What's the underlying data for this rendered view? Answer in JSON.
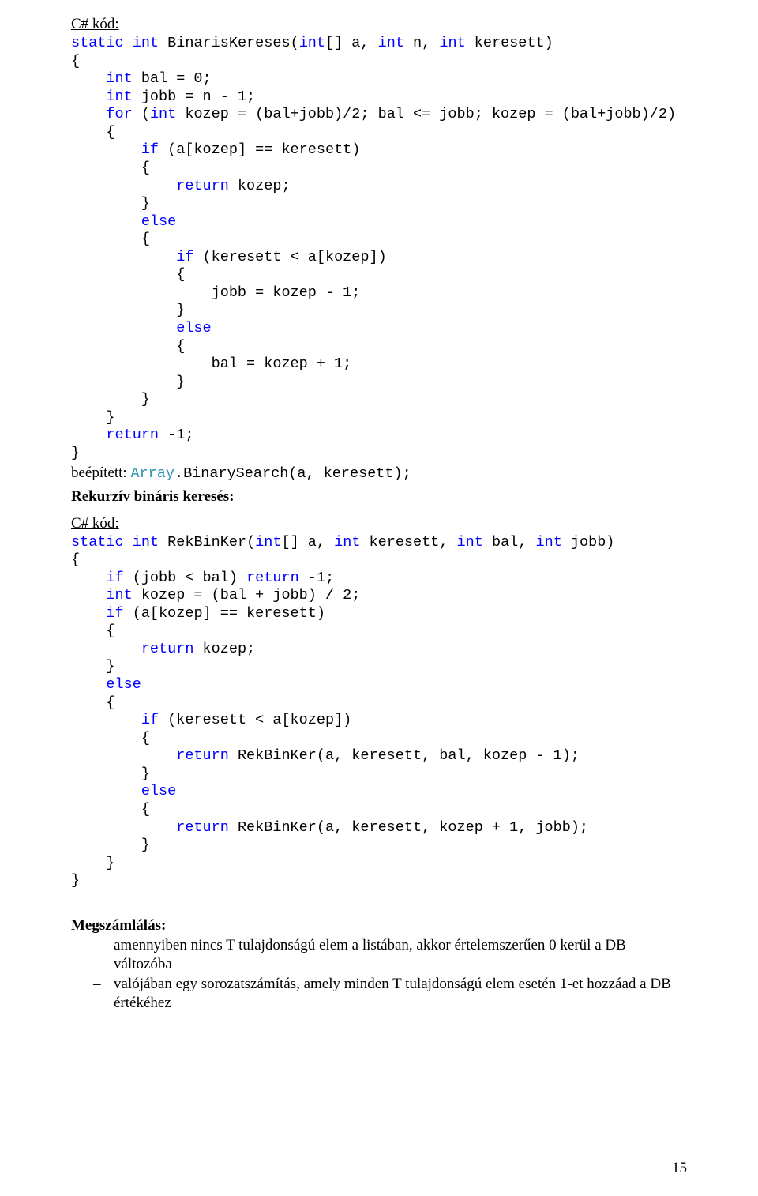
{
  "heading_code1": "C# kód:",
  "code1": {
    "l1a": "static",
    "l1b": " int",
    "l1c": " BinarisKereses(",
    "l1d": "int",
    "l1e": "[] a, ",
    "l1f": "int",
    "l1g": " n, ",
    "l1h": "int",
    "l1i": " keresett)",
    "l2": "{",
    "l3a": "    int",
    "l3b": " bal = 0;",
    "l4a": "    int",
    "l4b": " jobb = n - 1;",
    "l5a": "    for",
    "l5b": " (",
    "l5c": "int",
    "l5d": " kozep = (bal+jobb)/2; bal <= jobb; kozep = (bal+jobb)/2)",
    "l6": "    {",
    "l7a": "        if",
    "l7b": " (a[kozep] == keresett)",
    "l8": "        {",
    "l9a": "            return",
    "l9b": " kozep;",
    "l10": "        }",
    "l11a": "        else",
    "l12": "        {",
    "l13a": "            if",
    "l13b": " (keresett < a[kozep])",
    "l14": "            {",
    "l15": "                jobb = kozep - 1;",
    "l16": "            }",
    "l17a": "            else",
    "l18": "            {",
    "l19": "                bal = kozep + 1;",
    "l20": "            }",
    "l21": "        }",
    "l22": "    }",
    "l23a": "    return",
    "l23b": " -1;",
    "l24": "}"
  },
  "built_label": "beépített: ",
  "built_code_a": "Array",
  "built_code_b": ".BinarySearch(a, keresett);",
  "section_title": "Rekurzív bináris keresés:",
  "heading_code2": "C# kód:",
  "code2": {
    "l1a": "static",
    "l1b": " int",
    "l1c": " RekBinKer(",
    "l1d": "int",
    "l1e": "[] a, ",
    "l1f": "int",
    "l1g": " keresett, ",
    "l1h": "int",
    "l1i": " bal, ",
    "l1j": "int",
    "l1k": " jobb)",
    "l2": "{",
    "l3a": "    if",
    "l3b": " (jobb < bal) ",
    "l3c": "return",
    "l3d": " -1;",
    "l4a": "    int",
    "l4b": " kozep = (bal + jobb) / 2;",
    "l5a": "    if",
    "l5b": " (a[kozep] == keresett)",
    "l6": "    {",
    "l7a": "        return",
    "l7b": " kozep;",
    "l8": "    }",
    "l9a": "    else",
    "l10": "    {",
    "l11a": "        if",
    "l11b": " (keresett < a[kozep])",
    "l12": "        {",
    "l13a": "            return",
    "l13b": " RekBinKer(a, keresett, bal, kozep - 1);",
    "l14": "        }",
    "l15a": "        else",
    "l16": "        {",
    "l17a": "            return",
    "l17b": " RekBinKer(a, keresett, kozep + 1, jobb);",
    "l18": "        }",
    "l19": "    }",
    "l20": "}"
  },
  "subhead": "Megszámlálás:",
  "bullet1": "amennyiben nincs T tulajdonságú elem a listában, akkor értelemszerűen 0 kerül a DB változóba",
  "bullet2": "valójában egy sorozatszámítás, amely minden T tulajdonságú elem esetén 1-et hozzáad a DB értékéhez",
  "page_number": "15"
}
